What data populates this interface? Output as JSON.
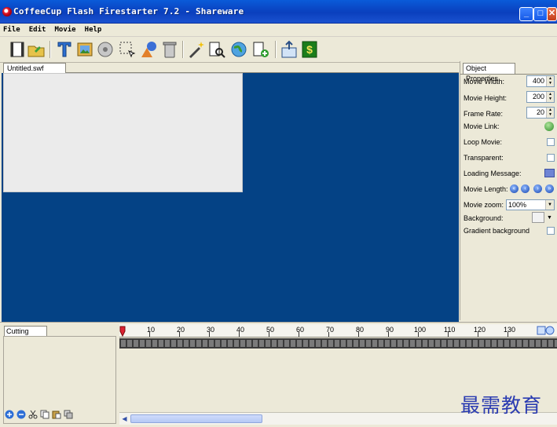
{
  "window": {
    "title": "CoffeeCup Flash Firestarter 7.2 - Shareware"
  },
  "menu": [
    {
      "label": "File"
    },
    {
      "label": "Edit"
    },
    {
      "label": "Movie"
    },
    {
      "label": "Help"
    }
  ],
  "document": {
    "tab_label": "Untitled.swf"
  },
  "properties": {
    "tab_label": "Object Properties",
    "movie_width_label": "Movie Width:",
    "movie_width": "400",
    "movie_height_label": "Movie Height:",
    "movie_height": "200",
    "frame_rate_label": "Frame Rate:",
    "frame_rate": "20",
    "movie_link_label": "Movie Link:",
    "loop_label": "Loop Movie:",
    "transparent_label": "Transparent:",
    "loading_label": "Loading Message:",
    "length_label": "Movie Length:",
    "zoom_label": "Movie zoom:",
    "zoom_value": "100%",
    "background_label": "Background:",
    "gradient_label": "Gradient background"
  },
  "cutting_room": {
    "tab_label": "Cutting Room"
  },
  "timeline": {
    "ruler_labels": [
      "10",
      "20",
      "30",
      "40",
      "50",
      "60",
      "70",
      "80",
      "90",
      "100",
      "110",
      "120",
      "130"
    ]
  },
  "watermark": "最需教育",
  "colors": {
    "stage_bg": "#044285",
    "stage": "#ebebeb",
    "titlebar": "#0a46c8"
  }
}
